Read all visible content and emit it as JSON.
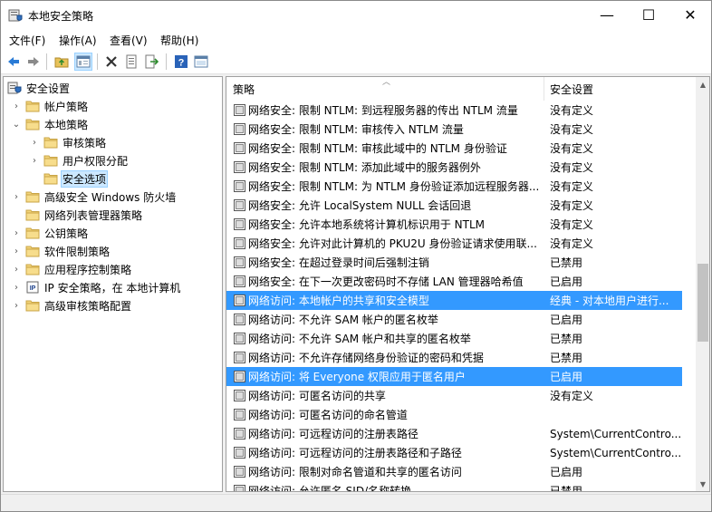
{
  "window": {
    "title": "本地安全策略",
    "minimize": "—",
    "maximize": "☐",
    "close": "✕"
  },
  "menu": [
    "文件(F)",
    "操作(A)",
    "查看(V)",
    "帮助(H)"
  ],
  "toolbar": [
    "back-icon",
    "forward-icon",
    "up-folder-icon",
    "show-tree-icon",
    "delete-icon",
    "properties-icon",
    "export-icon",
    "help-icon",
    "console-icon"
  ],
  "tree": [
    {
      "label": "安全设置",
      "level": 0,
      "expander": "",
      "icon": "security-settings-icon"
    },
    {
      "label": "帐户策略",
      "level": 1,
      "expander": "›",
      "icon": "folder-icon"
    },
    {
      "label": "本地策略",
      "level": 1,
      "expander": "⌄",
      "icon": "folder-icon"
    },
    {
      "label": "审核策略",
      "level": 2,
      "expander": "›",
      "icon": "folder-icon"
    },
    {
      "label": "用户权限分配",
      "level": 2,
      "expander": "›",
      "icon": "folder-icon"
    },
    {
      "label": "安全选项",
      "level": 2,
      "expander": "",
      "icon": "folder-icon",
      "selected": true
    },
    {
      "label": "高级安全 Windows 防火墙",
      "level": 1,
      "expander": "›",
      "icon": "folder-icon"
    },
    {
      "label": "网络列表管理器策略",
      "level": 1,
      "expander": "",
      "icon": "folder-icon"
    },
    {
      "label": "公钥策略",
      "level": 1,
      "expander": "›",
      "icon": "folder-icon"
    },
    {
      "label": "软件限制策略",
      "level": 1,
      "expander": "›",
      "icon": "folder-icon"
    },
    {
      "label": "应用程序控制策略",
      "level": 1,
      "expander": "›",
      "icon": "folder-icon"
    },
    {
      "label": "IP 安全策略，在 本地计算机",
      "level": 1,
      "expander": "›",
      "icon": "ip-security-icon"
    },
    {
      "label": "高级审核策略配置",
      "level": 1,
      "expander": "›",
      "icon": "folder-icon"
    }
  ],
  "list": {
    "columns": {
      "policy": "策略",
      "setting": "安全设置"
    },
    "rows": [
      {
        "policy": "网络安全: 限制 NTLM: 到远程服务器的传出 NTLM 流量",
        "setting": "没有定义"
      },
      {
        "policy": "网络安全: 限制 NTLM: 审核传入 NTLM 流量",
        "setting": "没有定义"
      },
      {
        "policy": "网络安全: 限制 NTLM: 审核此域中的 NTLM 身份验证",
        "setting": "没有定义"
      },
      {
        "policy": "网络安全: 限制 NTLM: 添加此域中的服务器例外",
        "setting": "没有定义"
      },
      {
        "policy": "网络安全: 限制 NTLM: 为 NTLM 身份验证添加远程服务器...",
        "setting": "没有定义"
      },
      {
        "policy": "网络安全: 允许 LocalSystem NULL 会话回退",
        "setting": "没有定义"
      },
      {
        "policy": "网络安全: 允许本地系统将计算机标识用于 NTLM",
        "setting": "没有定义"
      },
      {
        "policy": "网络安全: 允许对此计算机的 PKU2U 身份验证请求使用联...",
        "setting": "没有定义"
      },
      {
        "policy": "网络安全: 在超过登录时间后强制注销",
        "setting": "已禁用"
      },
      {
        "policy": "网络安全: 在下一次更改密码时不存储 LAN 管理器哈希值",
        "setting": "已启用"
      },
      {
        "policy": "网络访问: 本地帐户的共享和安全模型",
        "setting": "经典 - 对本地用户进行...",
        "selected": true
      },
      {
        "policy": "网络访问: 不允许 SAM 帐户的匿名枚举",
        "setting": "已启用"
      },
      {
        "policy": "网络访问: 不允许 SAM 帐户和共享的匿名枚举",
        "setting": "已禁用"
      },
      {
        "policy": "网络访问: 不允许存储网络身份验证的密码和凭据",
        "setting": "已禁用"
      },
      {
        "policy": "网络访问: 将 Everyone 权限应用于匿名用户",
        "setting": "已启用",
        "selected": true
      },
      {
        "policy": "网络访问: 可匿名访问的共享",
        "setting": "没有定义"
      },
      {
        "policy": "网络访问: 可匿名访问的命名管道",
        "setting": ""
      },
      {
        "policy": "网络访问: 可远程访问的注册表路径",
        "setting": "System\\CurrentContro..."
      },
      {
        "policy": "网络访问: 可远程访问的注册表路径和子路径",
        "setting": "System\\CurrentContro..."
      },
      {
        "policy": "网络访问: 限制对命名管道和共享的匿名访问",
        "setting": "已启用"
      },
      {
        "policy": "网络访问: 允许匿名 SID/名称转换",
        "setting": "已禁用"
      }
    ]
  },
  "colors": {
    "selection": "#3399ff",
    "tree_selection": "#cce8ff"
  }
}
